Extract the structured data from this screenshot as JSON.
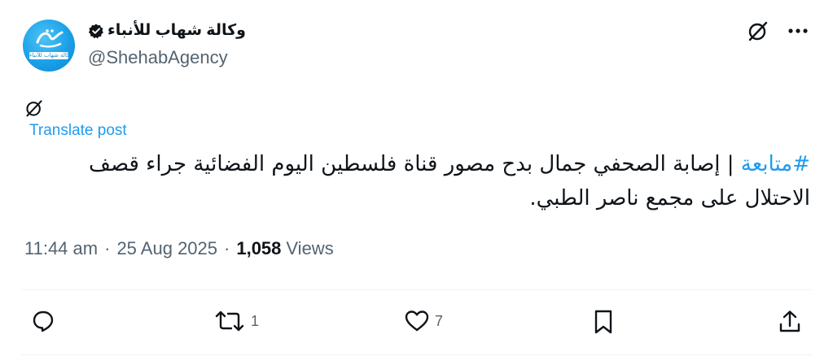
{
  "author": {
    "display_name": "وكالة شهاب للأنباء",
    "handle": "@ShehabAgency",
    "avatar_caption": "وكالة شهاب للأنباء",
    "verified": true
  },
  "header_actions": [
    "grok-icon",
    "more-icon"
  ],
  "translate_label": "Translate post",
  "post": {
    "hashtag": "#متابعة",
    "text": " | إصابة الصحفي جمال بدح مصور قناة فلسطين اليوم الفضائية جراء قصف الاحتلال على مجمع ناصر الطبي."
  },
  "meta": {
    "time": "11:44 am",
    "date": "25 Aug 2025",
    "separator": "·",
    "views_count": "1,058",
    "views_label": "Views"
  },
  "actions": {
    "reply_count": "",
    "repost_count": "1",
    "like_count": "7"
  },
  "colors": {
    "accent": "#1d9bf0",
    "text_primary": "#0f1419",
    "text_secondary": "#536471",
    "divider": "#eff3f4"
  }
}
